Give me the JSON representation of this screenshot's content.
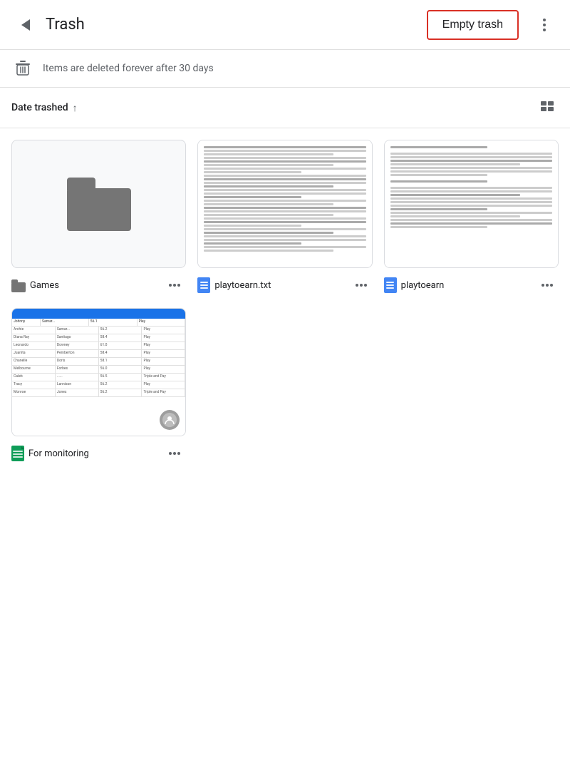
{
  "header": {
    "title": "Trash",
    "empty_trash_label": "Empty trash",
    "more_options_label": "More options"
  },
  "info_bar": {
    "message": "Items are deleted forever after 30 days"
  },
  "sort_bar": {
    "sort_label": "Date trashed",
    "sort_direction": "↑"
  },
  "files": [
    {
      "id": "games-folder",
      "name": "Games",
      "type": "folder",
      "thumbnail": "folder"
    },
    {
      "id": "playtoearn-txt",
      "name": "playtoearn.txt",
      "type": "doc",
      "thumbnail": "doc-text"
    },
    {
      "id": "playtoearn-doc",
      "name": "playtoearn",
      "type": "doc",
      "thumbnail": "doc-text2"
    },
    {
      "id": "for-monitoring",
      "name": "For monitoring",
      "type": "sheet",
      "thumbnail": "sheet",
      "shared": true
    }
  ],
  "icons": {
    "back": "‹",
    "more_dots": "•••",
    "trash_unicode": "🗑"
  }
}
